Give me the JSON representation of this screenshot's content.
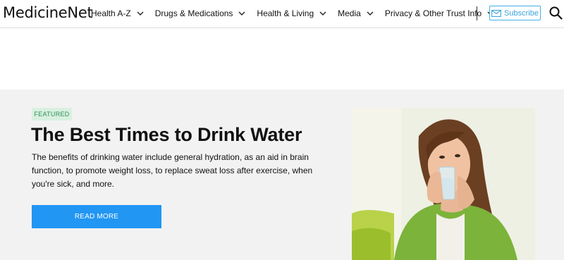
{
  "header": {
    "logo": "MedicineNet",
    "nav": [
      {
        "label": "Health A-Z"
      },
      {
        "label": "Drugs & Medications"
      },
      {
        "label": "Health & Living"
      },
      {
        "label": "Media"
      },
      {
        "label": "Privacy & Other Trust Info"
      }
    ],
    "subscribe_label": "Subscribe",
    "icons": {
      "subscribe": "mail-icon",
      "search": "search-icon",
      "nav": "chevron-down-icon"
    }
  },
  "featured": {
    "badge": "FEATURED",
    "title": "The Best Times to Drink Water",
    "description": "The benefits of drinking water include general hydration, as an aid in brain function, to promote weight loss, to replace sweat loss after exercise, when you're sick, and more.",
    "button_label": "READ MORE"
  },
  "colors": {
    "accent": "#2196f3",
    "subscribe": "#43b0e6",
    "badge_bg": "#d8f0e0",
    "badge_text": "#2f8f55",
    "section_bg": "#f2f2f2"
  }
}
